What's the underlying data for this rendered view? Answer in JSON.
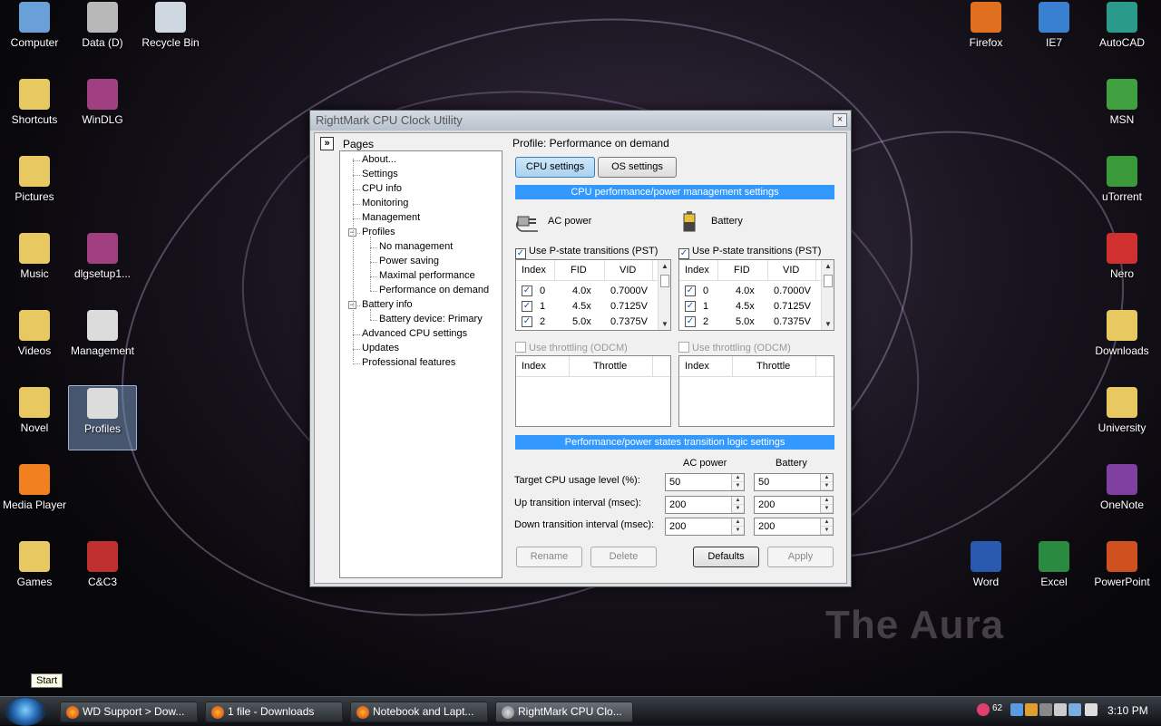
{
  "desktop": {
    "left_icons": [
      {
        "label": "Computer",
        "icon": "computer-icon"
      },
      {
        "label": "Data (D)",
        "icon": "drive-icon"
      },
      {
        "label": "Recycle Bin",
        "icon": "recycle-bin-icon"
      },
      {
        "label": "Shortcuts",
        "icon": "folder-icon"
      },
      {
        "label": "WinDLG",
        "icon": "archive-icon"
      },
      {
        "label": "Pictures",
        "icon": "folder-icon"
      },
      {
        "label": "Music",
        "icon": "folder-icon"
      },
      {
        "label": "dlgsetup1...",
        "icon": "archive-icon"
      },
      {
        "label": "Videos",
        "icon": "folder-icon"
      },
      {
        "label": "Management",
        "icon": "window-icon"
      },
      {
        "label": "Novel",
        "icon": "folder-icon"
      },
      {
        "label": "Profiles",
        "icon": "window-icon"
      },
      {
        "label": "Media Player",
        "icon": "media-player-icon"
      },
      {
        "label": "Games",
        "icon": "folder-icon"
      },
      {
        "label": "C&C3",
        "icon": "game-icon"
      }
    ],
    "right_icons": [
      {
        "label": "Firefox",
        "icon": "firefox-icon"
      },
      {
        "label": "IE7",
        "icon": "ie-icon"
      },
      {
        "label": "AutoCAD",
        "icon": "autocad-icon"
      },
      {
        "label": "MSN",
        "icon": "msn-icon"
      },
      {
        "label": "uTorrent",
        "icon": "utorrent-icon"
      },
      {
        "label": "Nero",
        "icon": "nero-icon"
      },
      {
        "label": "Downloads",
        "icon": "folder-icon"
      },
      {
        "label": "University",
        "icon": "folder-icon"
      },
      {
        "label": "OneNote",
        "icon": "onenote-icon"
      },
      {
        "label": "Word",
        "icon": "word-icon"
      },
      {
        "label": "Excel",
        "icon": "excel-icon"
      },
      {
        "label": "PowerPoint",
        "icon": "powerpoint-icon"
      }
    ],
    "watermark": "The Aura"
  },
  "window": {
    "title": "RightMark CPU Clock Utility",
    "close": "×",
    "collapse": "»",
    "pages_label": "Pages",
    "tree": [
      "About...",
      "Settings",
      "CPU info",
      "Monitoring",
      "Management",
      "Profiles",
      "No management",
      "Power saving",
      "Maximal performance",
      "Performance on demand",
      "Battery info",
      "Battery device: Primary",
      "Advanced CPU settings",
      "Updates",
      "Professional features"
    ],
    "profile_label": "Profile: Performance on demand",
    "tabs": {
      "cpu": "CPU settings",
      "os": "OS settings"
    },
    "header1": "CPU performance/power management settings",
    "ac_label": "AC power",
    "battery_label": "Battery",
    "pst_label": "Use P-state transitions (PST)",
    "pst_cols": [
      "Index",
      "FID",
      "VID"
    ],
    "pst_rows": [
      {
        "index": "0",
        "fid": "4.0x",
        "vid": "0.7000V"
      },
      {
        "index": "1",
        "fid": "4.5x",
        "vid": "0.7125V"
      },
      {
        "index": "2",
        "fid": "5.0x",
        "vid": "0.7375V"
      }
    ],
    "throttle_label": "Use throttling (ODCM)",
    "throttle_cols": [
      "Index",
      "Throttle"
    ],
    "header2": "Performance/power states transition logic settings",
    "col_ac": "AC power",
    "col_battery": "Battery",
    "fields": [
      {
        "label": "Target CPU usage level (%):",
        "ac": "50",
        "battery": "50"
      },
      {
        "label": "Up transition interval (msec):",
        "ac": "200",
        "battery": "200"
      },
      {
        "label": "Down transition interval (msec):",
        "ac": "200",
        "battery": "200"
      }
    ],
    "buttons": {
      "rename": "Rename",
      "delete": "Delete",
      "defaults": "Defaults",
      "apply": "Apply"
    }
  },
  "taskbar": {
    "start_tooltip": "Start",
    "tasks": [
      "WD Support > Dow...",
      "1 file - Downloads",
      "Notebook and Lapt...",
      "RightMark CPU Clo..."
    ],
    "tray_number": "62",
    "clock": "3:10 PM"
  },
  "colors": {
    "accent": "#3399ff"
  }
}
